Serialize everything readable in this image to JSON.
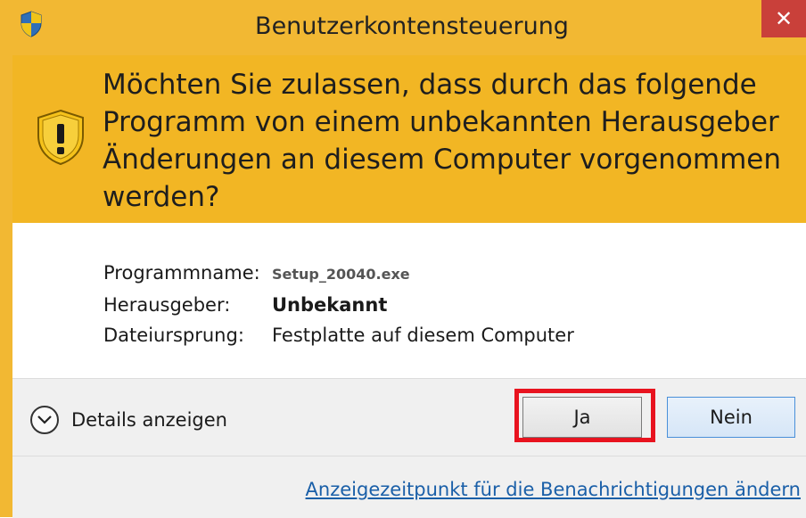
{
  "window": {
    "title": "Benutzerkontensteuerung",
    "close_label": "✕"
  },
  "header": {
    "question": "Möchten Sie zulassen, dass durch das folgende Programm von einem unbekannten Herausgeber Änderungen an diesem Computer vorgenommen werden?"
  },
  "info": {
    "program_label": "Programmname:",
    "program_value": "Setup_20040.exe",
    "publisher_label": "Herausgeber:",
    "publisher_value": "Unbekannt",
    "origin_label": "Dateiursprung:",
    "origin_value": "Festplatte auf diesem Computer"
  },
  "footer": {
    "details_label": "Details anzeigen",
    "yes_label": "Ja",
    "no_label": "Nein",
    "link_label": "Anzeigezeitpunkt für die Benachrichtigungen ändern"
  },
  "colors": {
    "header_bg": "#f2b624",
    "close_bg": "#c9403a",
    "highlight": "#e8131f",
    "link": "#1a5fa8"
  },
  "icons": {
    "title_icon": "uac-shield-icon",
    "warning_icon": "warning-shield-icon",
    "details_icon": "chevron-down-icon"
  }
}
